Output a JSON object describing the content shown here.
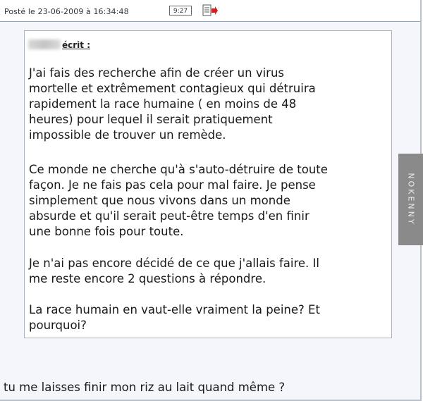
{
  "post": {
    "posted_label": "Posté le 23-06-2009 à 16:34:48",
    "profile_icon_text": "9:27"
  },
  "quote": {
    "author_suffix": "écrit :",
    "paragraphs": [
      "J'ai fais des recherche afin de créer un virus\nmortelle et extrêmement contagieux qui détruira\nrapidement la race humaine ( en moins de 48\nheures) pour lequel il serait pratiquement\nimpossible de trouver un remède.",
      "Ce monde ne cherche qu'à s'auto-détruire de toute\nfaçon. Je ne fais pas cela pour mal faire. Je pense\nsimplement que nous vivons dans un monde\nabsurde et qu'il serait peut-être temps d'en finir\nune bonne fois pour toute.",
      "Je n'ai pas encore décidé de ce que j'allais faire. Il\nme reste encore 2 questions à répondre.",
      "La race humain en vaut-elle vraiment la peine? Et\npourquoi?"
    ]
  },
  "reply_text": "tu me laisses finir mon riz au lait quand même ?",
  "watermark": "NOKENNY"
}
